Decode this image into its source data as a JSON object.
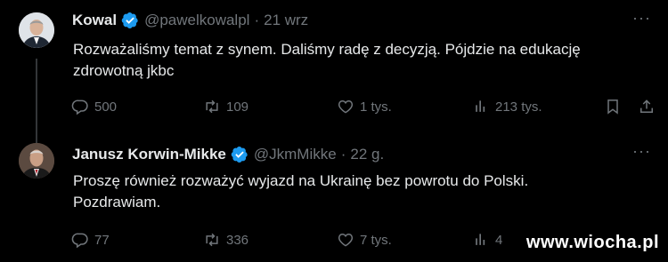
{
  "tweets": [
    {
      "author_name": "Kowal",
      "handle": "@pawelkowalpl",
      "separator": "·",
      "time": "21 wrz",
      "text_line1": "Rozważaliśmy temat z synem. Daliśmy radę z decyzją. Pójdzie na edukację",
      "text_line2": "zdrowotną jkbc",
      "replies": "500",
      "retweets": "109",
      "likes": "1 tys.",
      "views": "213 tys."
    },
    {
      "author_name": "Janusz Korwin-Mikke",
      "handle": "@JkmMikke",
      "separator": "·",
      "time": "22 g.",
      "text_line1": "Proszę również rozważyć wyjazd na Ukrainę bez powrotu do Polski.",
      "text_line2": "Pozdrawiam.",
      "replies": "77",
      "retweets": "336",
      "likes": "7 tys.",
      "views": "4"
    }
  ],
  "more_label": "···",
  "watermark": "www.wiocha.pl",
  "colors": {
    "background": "#000000",
    "text": "#e7e9ea",
    "muted": "#71767b",
    "verified": "#1d9bf0"
  }
}
